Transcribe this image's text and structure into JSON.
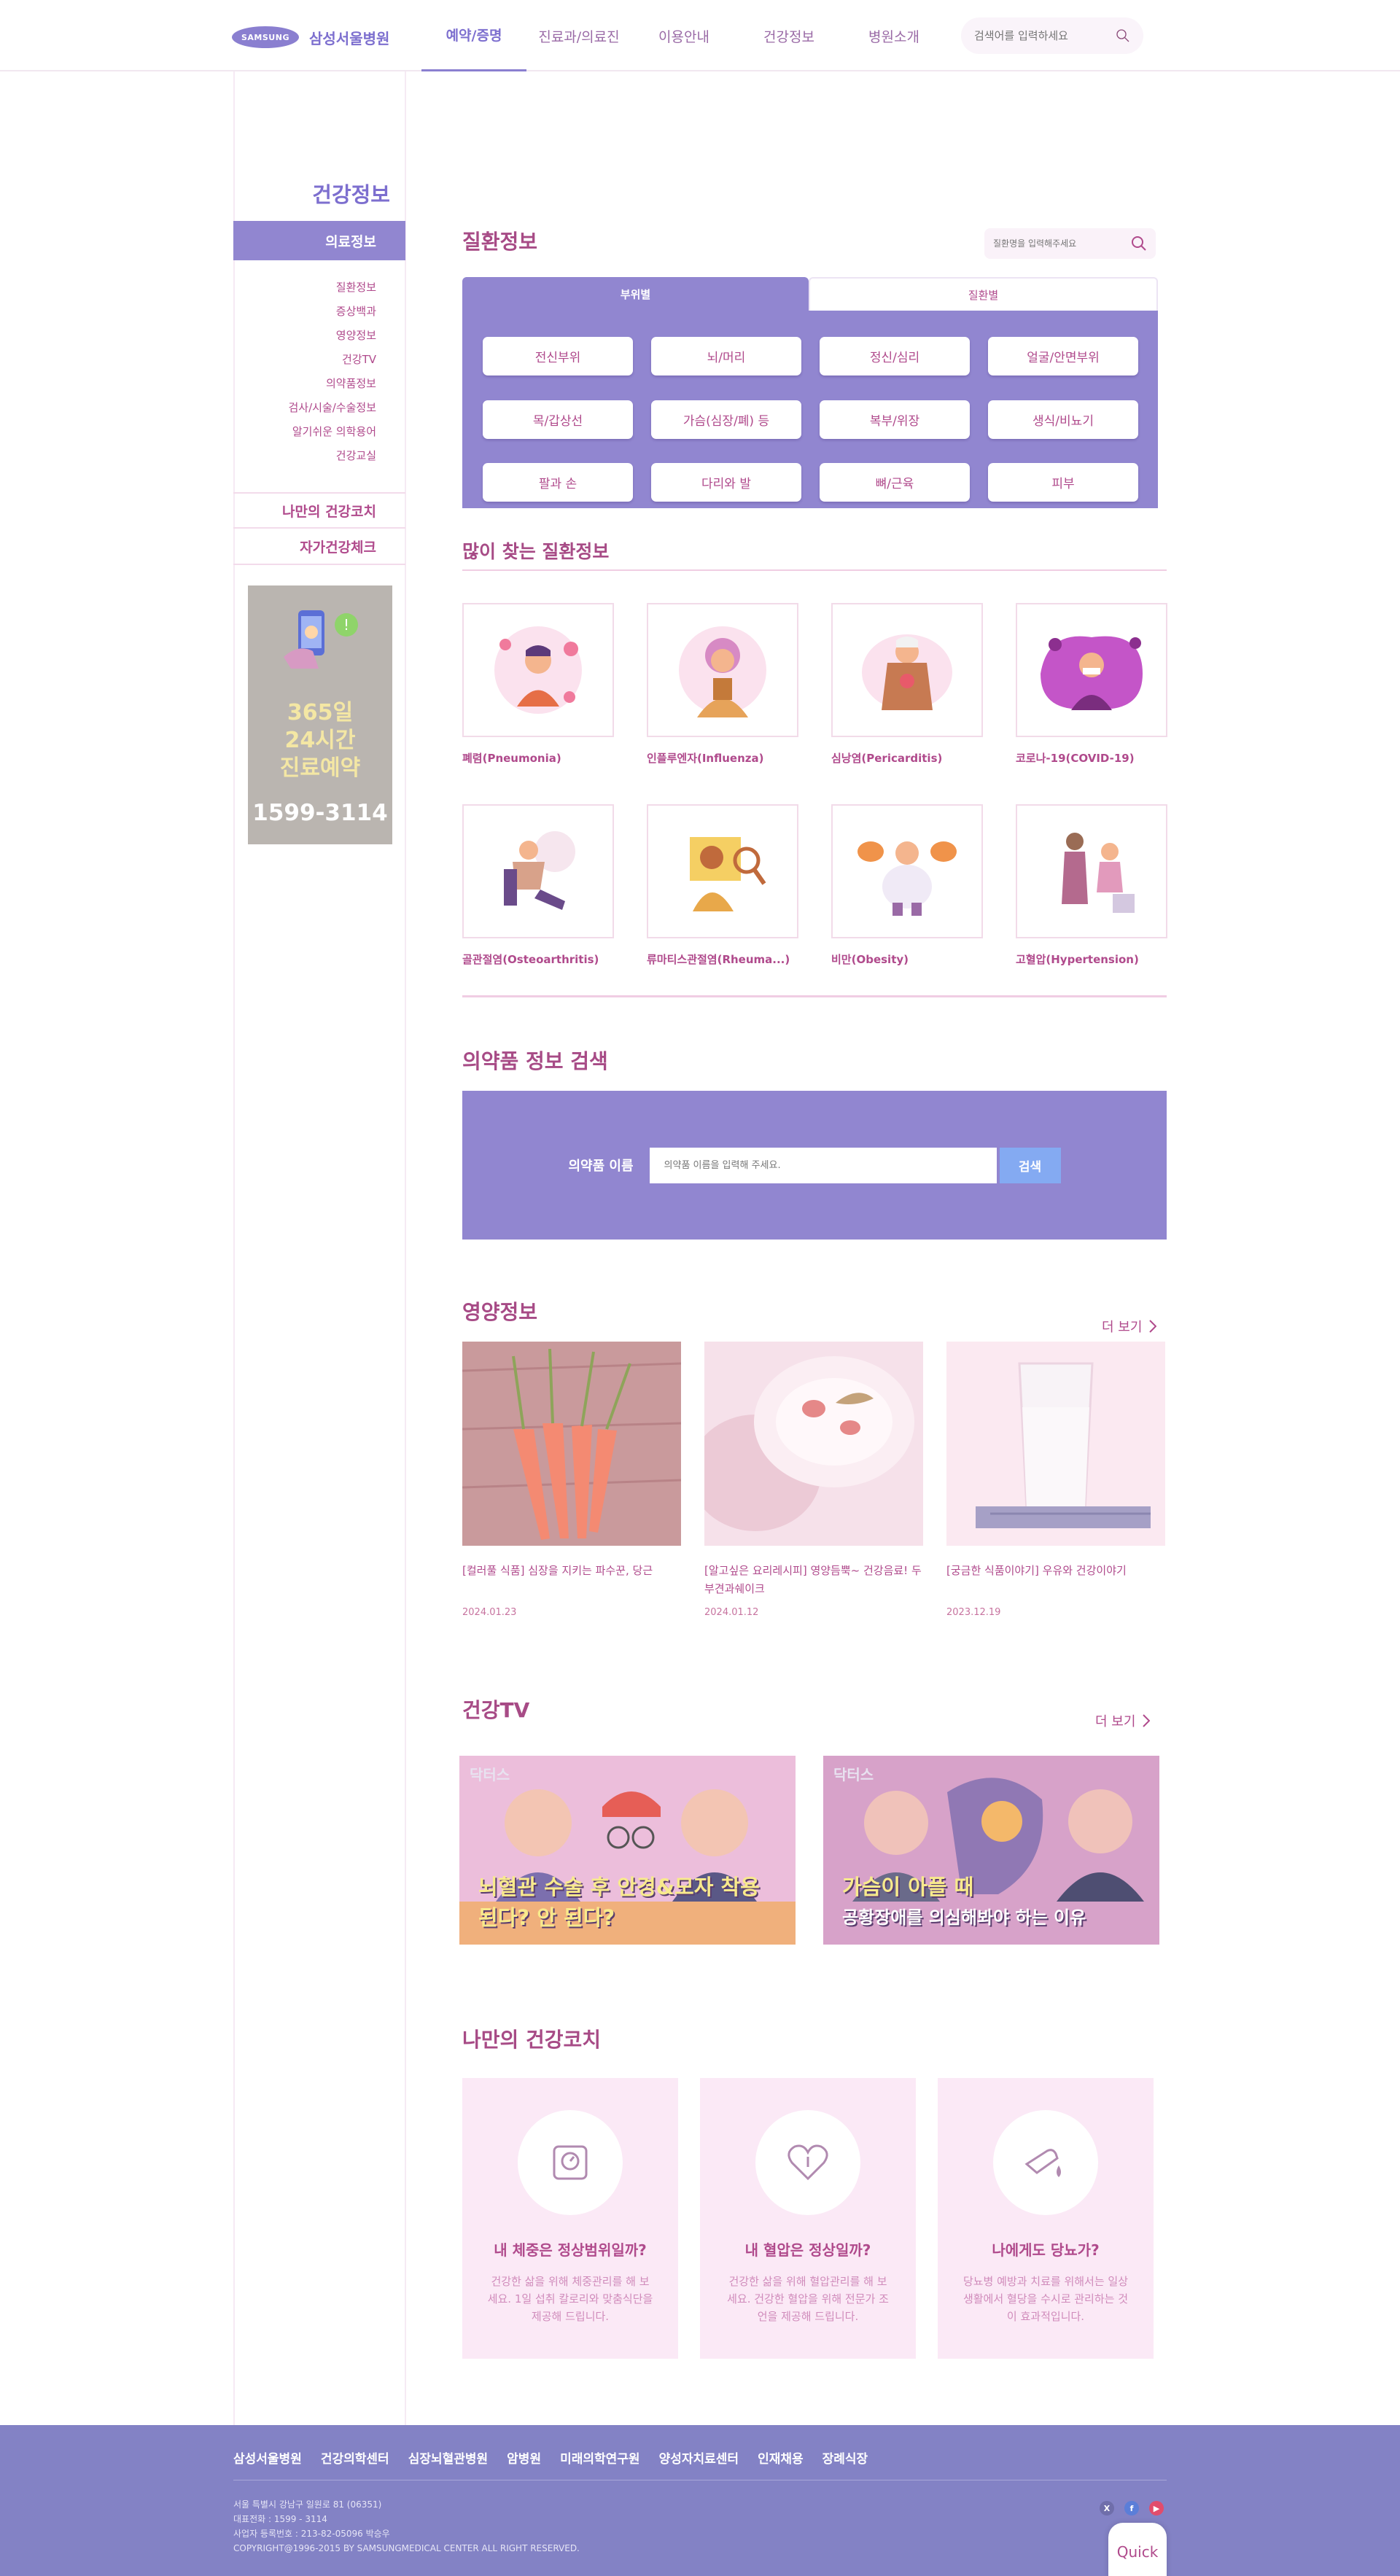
{
  "header": {
    "logo_mark": "SAMSUNG",
    "logo_text": "삼성서울병원",
    "nav": [
      "예약/증명",
      "진료과/의료진",
      "이용안내",
      "건강정보",
      "병원소개"
    ],
    "search_placeholder": "검색어를 입력하세요"
  },
  "sidebar": {
    "title": "건강정보",
    "active": "의료정보",
    "sub": [
      "질환정보",
      "증상백과",
      "영양정보",
      "건강TV",
      "의약품정보",
      "검사/시술/수술정보",
      "알기쉬운 의학용어",
      "건강교실"
    ],
    "menu": [
      "나만의 건강코치",
      "자가건강체크"
    ],
    "banner": {
      "lines": [
        "365일",
        "24시간",
        "진료예약"
      ],
      "phone": "1599-3114"
    }
  },
  "disease": {
    "title": "질환정보",
    "search_placeholder": "질환명을 입력해주세요",
    "tabs": [
      "부위별",
      "질환별"
    ],
    "body_parts": [
      "전신부위",
      "뇌/머리",
      "정신/심리",
      "얼굴/안면부위",
      "목/갑상선",
      "가슴(심장/폐) 등",
      "복부/위장",
      "생식/비뇨기",
      "팔과 손",
      "다리와 발",
      "뼈/근육",
      "피부"
    ]
  },
  "popular": {
    "title": "많이 찾는 질환정보",
    "items": [
      {
        "label": "폐렴(Pneumonia)",
        "icon": "pneumonia-illustration"
      },
      {
        "label": "인플루엔자(Influenza)",
        "icon": "influenza-illustration"
      },
      {
        "label": "심낭염(Pericarditis)",
        "icon": "pericarditis-illustration"
      },
      {
        "label": "코로나-19(COVID-19)",
        "icon": "covid-illustration"
      },
      {
        "label": "골관절염(Osteoarthritis)",
        "icon": "osteoarthritis-illustration"
      },
      {
        "label": "류마티스관절염(Rheuma...)",
        "icon": "rheumatoid-illustration"
      },
      {
        "label": "비만(Obesity)",
        "icon": "obesity-illustration"
      },
      {
        "label": "고혈압(Hypertension)",
        "icon": "hypertension-illustration"
      }
    ]
  },
  "drug": {
    "title": "의약품 정보 검색",
    "label": "의약품 이름",
    "placeholder": "의약품 이름을 입력해 주세요.",
    "button": "검색"
  },
  "nutrition": {
    "title": "영양정보",
    "more": "더 보기",
    "items": [
      {
        "title": "[컬러풀 식품] 심장을 지키는 파수꾼, 당근",
        "date": "2024.01.23"
      },
      {
        "title": "[알고싶은 요리레시피] 영양듬뿍~ 건강음료! 두부견과쉐이크",
        "date": "2024.01.12"
      },
      {
        "title": "[궁금한 식품이야기] 우유와 건강이야기",
        "date": "2023.12.19"
      }
    ]
  },
  "tv": {
    "title": "건강TV",
    "more": "더 보기",
    "items": [
      {
        "brand": "닥터스",
        "caption1": "뇌혈관 수술 후 안경&모자 착용",
        "caption2": "된다? 안 된다?"
      },
      {
        "brand": "닥터스",
        "caption1": "가슴이 아플 때",
        "caption2": "공황장애를 의심해봐야 하는 이유"
      }
    ]
  },
  "coach": {
    "title": "나만의 건강코치",
    "items": [
      {
        "title": "내 체중은 정상범위일까?",
        "desc": "건강한 삶을 위해 체중관리를 해 보세요. 1일 섭취 칼로리와 맞춤식단을 제공해 드립니다.",
        "icon": "scale-icon"
      },
      {
        "title": "내 혈압은 정상일까?",
        "desc": "건강한 삶을 위해 혈압관리를 해 보세요. 건강한 혈압을 위해 전문가 조언을 제공해 드립니다.",
        "icon": "heart-pressure-icon"
      },
      {
        "title": "나에게도 당뇨가?",
        "desc": "당뇨병 예방과 치료를 위해서는 일상생활에서 혈당을 수시로 관리하는 것이 효과적입니다.",
        "icon": "glucose-icon"
      }
    ]
  },
  "footer": {
    "links": [
      "삼성서울병원",
      "건강의학센터",
      "심장뇌혈관병원",
      "암병원",
      "미래의학연구원",
      "양성자치료센터",
      "인재채용",
      "장례식장"
    ],
    "info": [
      "서울 특별시 강남구 일원로 81 (06351)",
      "대표전화 : 1599 - 3114",
      "사업자 등록번호 : 213-82-05096 박승우",
      "COPYRIGHT@1996-2015 BY SAMSUNGMEDICAL CENTER ALL RIGHT RESERVED."
    ],
    "sns": [
      "X",
      "f",
      "▶"
    ],
    "quick": "Quick"
  },
  "colors": {
    "accent": "#9186d0",
    "text": "#b04a8c",
    "footer": "#8382c5",
    "banner": "#bab5b0"
  }
}
